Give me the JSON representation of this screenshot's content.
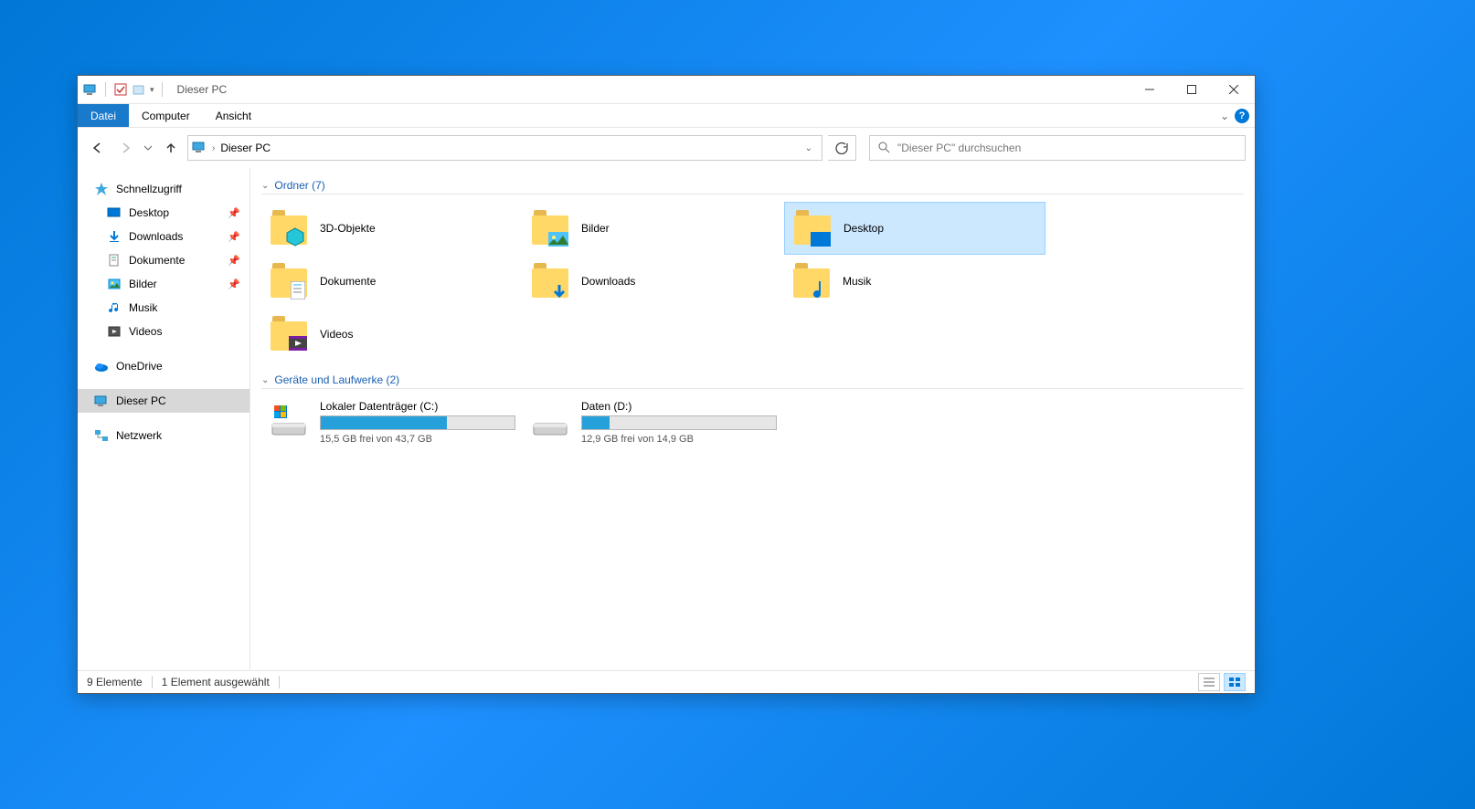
{
  "window": {
    "title": "Dieser PC",
    "menu": {
      "file": "Datei",
      "computer": "Computer",
      "view": "Ansicht"
    },
    "address": "Dieser PC",
    "search_placeholder": "\"Dieser PC\" durchsuchen"
  },
  "sidebar": {
    "quick_access": "Schnellzugriff",
    "items": [
      {
        "label": "Desktop",
        "pinned": true
      },
      {
        "label": "Downloads",
        "pinned": true
      },
      {
        "label": "Dokumente",
        "pinned": true
      },
      {
        "label": "Bilder",
        "pinned": true
      },
      {
        "label": "Musik",
        "pinned": false
      },
      {
        "label": "Videos",
        "pinned": false
      }
    ],
    "onedrive": "OneDrive",
    "this_pc": "Dieser PC",
    "network": "Netzwerk"
  },
  "groups": {
    "folders": {
      "header": "Ordner (7)"
    },
    "drives": {
      "header": "Geräte und Laufwerke (2)"
    }
  },
  "folders": [
    {
      "label": "3D-Objekte",
      "icon": "3d"
    },
    {
      "label": "Bilder",
      "icon": "pictures"
    },
    {
      "label": "Desktop",
      "icon": "desktop",
      "selected": true
    },
    {
      "label": "Dokumente",
      "icon": "documents"
    },
    {
      "label": "Downloads",
      "icon": "downloads"
    },
    {
      "label": "Musik",
      "icon": "music"
    },
    {
      "label": "Videos",
      "icon": "videos"
    }
  ],
  "drives": [
    {
      "name": "Lokaler Datenträger (C:)",
      "free_text": "15,5 GB frei von 43,7 GB",
      "fill_pct": 65,
      "os": true
    },
    {
      "name": "Daten (D:)",
      "free_text": "12,9 GB frei von 14,9 GB",
      "fill_pct": 14,
      "os": false
    }
  ],
  "status": {
    "count": "9 Elemente",
    "selection": "1 Element ausgewählt"
  }
}
